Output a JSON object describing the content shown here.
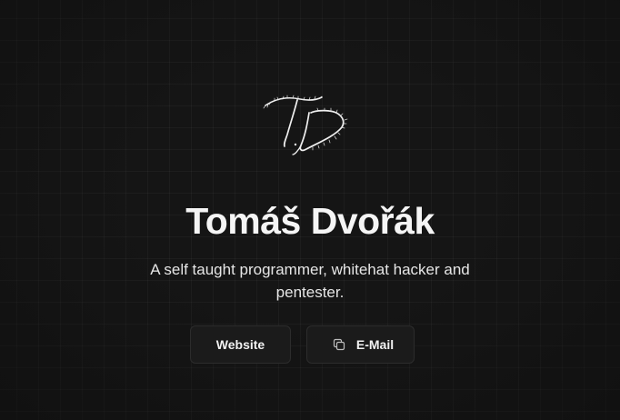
{
  "profile": {
    "name": "Tomáš Dvořák",
    "tagline": "A self taught programmer, whitehat hacker and pentester."
  },
  "logo": {
    "icon": "td-signature-monogram-icon",
    "color": "#f0f0f0"
  },
  "actions": {
    "website_label": "Website",
    "email_label": "E-Mail",
    "email_icon": "copy-icon"
  },
  "theme": {
    "background": "#151515",
    "text": "#f5f5f5",
    "button_background": "#1b1b1b",
    "button_border": "#2c2c2c"
  }
}
